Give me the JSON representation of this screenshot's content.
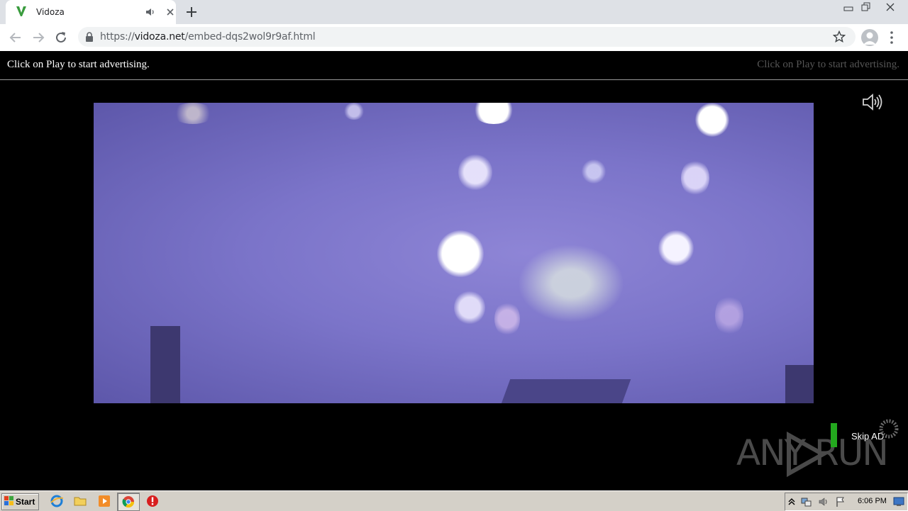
{
  "browser": {
    "tab": {
      "title": "Vidoza"
    },
    "url": {
      "scheme": "https://",
      "host": "vidoza.net",
      "path": "/embed-dqs2wol9r9af.html"
    }
  },
  "page": {
    "ad_notice_left": "Click on Play to start advertising.",
    "ad_notice_right": "Click on Play to start advertising.",
    "skip_label": "Skip AD",
    "watermark": "ANY RUN"
  },
  "taskbar": {
    "start_label": "Start",
    "clock": "6:06 PM"
  },
  "icons": {
    "favicon": "vidoza-v-icon",
    "tab_audio": "speaker-icon",
    "player_volume": "speaker-icon",
    "lock": "lock-icon",
    "bookmark": "star-icon"
  },
  "colors": {
    "favicon_green": "#3a9c3e",
    "skip_bar_green": "#23a81e",
    "video_tint": "#7b74c9"
  }
}
